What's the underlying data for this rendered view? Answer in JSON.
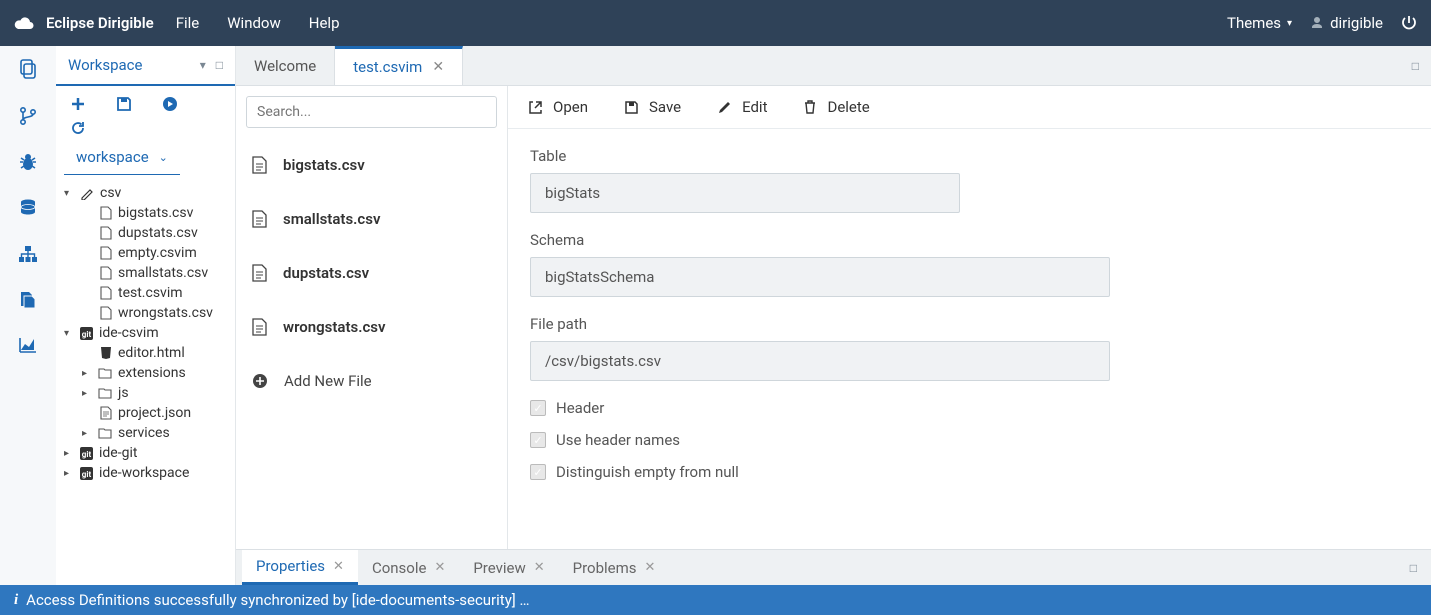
{
  "topbar": {
    "brand": "Eclipse Dirigible",
    "menus": [
      "File",
      "Window",
      "Help"
    ],
    "themes_label": "Themes",
    "user": "dirigible"
  },
  "workspace": {
    "title": "Workspace",
    "selector": "workspace",
    "tree": {
      "csv": {
        "label": "csv",
        "files": [
          "bigstats.csv",
          "dupstats.csv",
          "empty.csvim",
          "smallstats.csv",
          "test.csvim",
          "wrongstats.csv"
        ]
      },
      "ide_csvim": {
        "label": "ide-csvim",
        "editor": "editor.html",
        "folders": [
          "extensions",
          "js"
        ],
        "project_file": "project.json",
        "services": "services"
      },
      "ide_git": "ide-git",
      "ide_workspace": "ide-workspace"
    }
  },
  "editor": {
    "tabs": [
      {
        "label": "Welcome",
        "active": false,
        "closable": false
      },
      {
        "label": "test.csvim",
        "active": true,
        "closable": true
      }
    ],
    "search_placeholder": "Search...",
    "files": [
      "bigstats.csv",
      "smallstats.csv",
      "dupstats.csv",
      "wrongstats.csv"
    ],
    "add_new": "Add New File",
    "toolbar": {
      "open": "Open",
      "save": "Save",
      "edit": "Edit",
      "delete": "Delete"
    },
    "form": {
      "table_label": "Table",
      "table_value": "bigStats",
      "schema_label": "Schema",
      "schema_value": "bigStatsSchema",
      "filepath_label": "File path",
      "filepath_value": "/csv/bigstats.csv",
      "check_header": "Header",
      "check_use_header_names": "Use header names",
      "check_distinguish": "Distinguish empty from null"
    }
  },
  "bottom_tabs": [
    "Properties",
    "Console",
    "Preview",
    "Problems"
  ],
  "status": "Access Definitions successfully synchronized by [ide-documents-security] …"
}
